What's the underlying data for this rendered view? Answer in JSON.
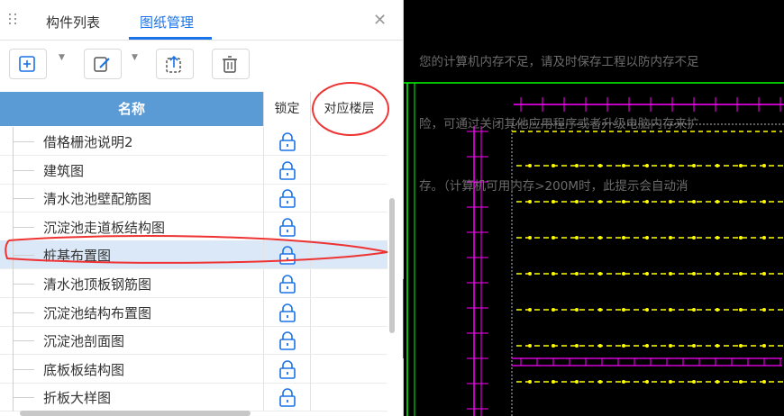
{
  "tabs": [
    {
      "label": "构件列表",
      "active": false
    },
    {
      "label": "图纸管理",
      "active": true
    }
  ],
  "toolbar": {
    "buttons": [
      "add-drawing-icon",
      "edit-drawing-icon",
      "import-icon",
      "delete-icon"
    ]
  },
  "table": {
    "headers": {
      "name": "名称",
      "lock": "锁定",
      "floor": "对应楼层"
    },
    "rows": [
      {
        "name": "借格栅池说明2",
        "locked": true,
        "floor": ""
      },
      {
        "name": "建筑图",
        "locked": true,
        "floor": ""
      },
      {
        "name": "清水池池壁配筋图",
        "locked": true,
        "floor": ""
      },
      {
        "name": "沉淀池走道板结构图",
        "locked": true,
        "floor": ""
      },
      {
        "name": "桩基布置图",
        "locked": true,
        "floor": "",
        "selected": true
      },
      {
        "name": "清水池顶板钢筋图",
        "locked": true,
        "floor": ""
      },
      {
        "name": "沉淀池结构布置图",
        "locked": true,
        "floor": ""
      },
      {
        "name": "沉淀池剖面图",
        "locked": true,
        "floor": ""
      },
      {
        "name": "底板板结构图",
        "locked": true,
        "floor": ""
      },
      {
        "name": "折板大样图",
        "locked": true,
        "floor": ""
      }
    ]
  },
  "cad": {
    "message_lines": [
      "您的计算机内存不足，请及时保存工程以防内存不足",
      "险，可通过关闭其他应用程序或者升级电脑内存来扩",
      "存。（计算机可用内存>200M时，此提示会自动消"
    ]
  },
  "colors": {
    "accent": "#1a73e8",
    "header": "#5b9bd5",
    "selected": "#dbe8f7",
    "annotation": "#e33",
    "cad_magenta": "#ff00ff",
    "cad_yellow": "#ffff00",
    "cad_green": "#00ff00"
  }
}
